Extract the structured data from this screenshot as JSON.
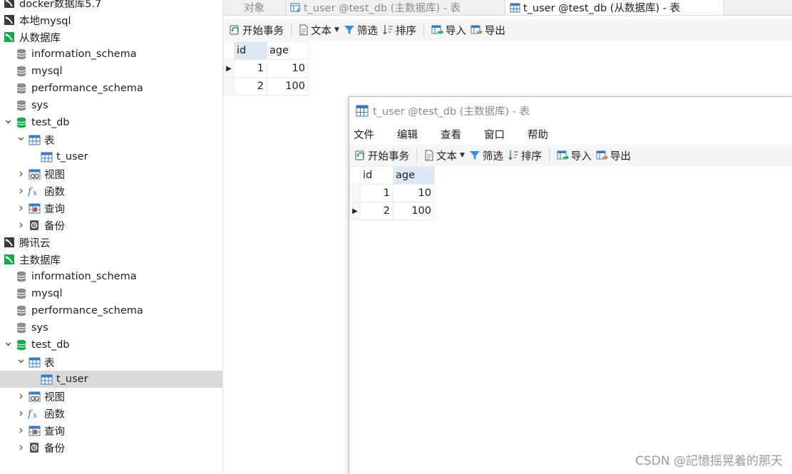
{
  "sidebar": {
    "items": [
      {
        "label": "docker数据库5.7",
        "indent": 0,
        "icon": "connection-icon"
      },
      {
        "label": "本地mysql",
        "indent": 0,
        "icon": "connection-icon"
      },
      {
        "label": "从数据库",
        "indent": 0,
        "icon": "connection-active-icon"
      },
      {
        "label": "information_schema",
        "indent": 1,
        "icon": "database-icon"
      },
      {
        "label": "mysql",
        "indent": 1,
        "icon": "database-icon"
      },
      {
        "label": "performance_schema",
        "indent": 1,
        "icon": "database-icon"
      },
      {
        "label": "sys",
        "indent": 1,
        "icon": "database-icon"
      },
      {
        "label": "test_db",
        "indent": 1,
        "icon": "database-open-icon",
        "expanded": true
      },
      {
        "label": "表",
        "indent": 2,
        "icon": "table-folder-icon",
        "expanded": true
      },
      {
        "label": "t_user",
        "indent": 3,
        "icon": "table-icon"
      },
      {
        "label": "视图",
        "indent": 2,
        "icon": "view-icon",
        "collapsed": true
      },
      {
        "label": "函数",
        "indent": 2,
        "icon": "function-icon",
        "collapsed": true
      },
      {
        "label": "查询",
        "indent": 2,
        "icon": "query-icon",
        "collapsed": true
      },
      {
        "label": "备份",
        "indent": 2,
        "icon": "backup-icon",
        "collapsed": true
      },
      {
        "label": "腾讯云",
        "indent": 0,
        "icon": "connection-icon"
      },
      {
        "label": "主数据库",
        "indent": 0,
        "icon": "connection-active-icon"
      },
      {
        "label": "information_schema",
        "indent": 1,
        "icon": "database-icon"
      },
      {
        "label": "mysql",
        "indent": 1,
        "icon": "database-icon"
      },
      {
        "label": "performance_schema",
        "indent": 1,
        "icon": "database-icon"
      },
      {
        "label": "sys",
        "indent": 1,
        "icon": "database-icon"
      },
      {
        "label": "test_db",
        "indent": 1,
        "icon": "database-open-icon",
        "expanded": true
      },
      {
        "label": "表",
        "indent": 2,
        "icon": "table-folder-icon",
        "expanded": true
      },
      {
        "label": "t_user",
        "indent": 3,
        "icon": "table-icon",
        "selected": true
      },
      {
        "label": "视图",
        "indent": 2,
        "icon": "view-icon",
        "collapsed": true
      },
      {
        "label": "函数",
        "indent": 2,
        "icon": "function-icon",
        "collapsed": true
      },
      {
        "label": "查询",
        "indent": 2,
        "icon": "query-icon",
        "collapsed": true
      },
      {
        "label": "备份",
        "indent": 2,
        "icon": "backup-icon",
        "collapsed": true
      }
    ]
  },
  "tabs": [
    {
      "label": "对象"
    },
    {
      "label": "t_user @test_db (主数据库) - 表"
    },
    {
      "label": "t_user @test_db (从数据库) - 表",
      "active": true
    }
  ],
  "toolbar": {
    "begin_tx": "开始事务",
    "text": "文本",
    "filter": "筛选",
    "sort": "排序",
    "import": "导入",
    "export": "导出"
  },
  "grid_main": {
    "columns": [
      "id",
      "age"
    ],
    "rows": [
      [
        "1",
        "10"
      ],
      [
        "2",
        "100"
      ]
    ]
  },
  "subwindow": {
    "title": "t_user @test_db (主数据库) - 表",
    "menu": [
      "文件",
      "编辑",
      "查看",
      "窗口",
      "帮助"
    ],
    "toolbar": {
      "begin_tx": "开始事务",
      "text": "文本",
      "filter": "筛选",
      "sort": "排序",
      "import": "导入",
      "export": "导出"
    },
    "grid": {
      "columns": [
        "id",
        "age"
      ],
      "rows": [
        [
          "1",
          "10"
        ],
        [
          "2",
          "100"
        ]
      ]
    }
  },
  "watermark": "CSDN @記憶摇晃着的那天",
  "colors": {
    "accent_green": "#1aa84a",
    "table_blue": "#3b79c2",
    "selected_row": "#d9d9d9",
    "header_selected": "#dbe9f7"
  }
}
